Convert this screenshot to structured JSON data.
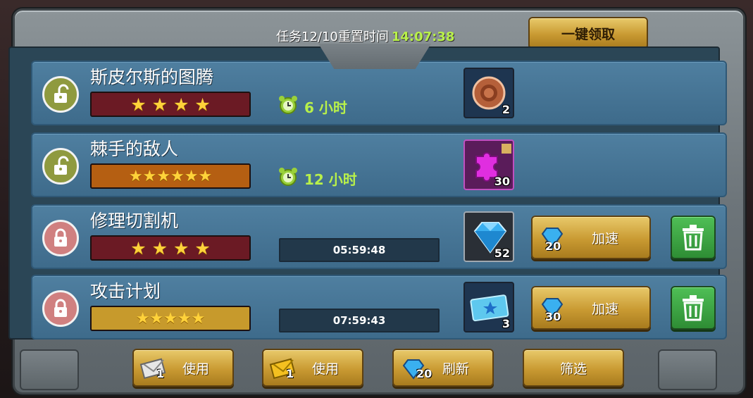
{
  "header": {
    "task_label": "任务12/10重置时间",
    "reset_time": "14:07:38",
    "claim_all_label": "一键领取"
  },
  "tasks": [
    {
      "title": "斯皮尔斯的图腾",
      "stars": 4,
      "stars_text": "★ ★ ★ ★",
      "lock_state": "unlocked",
      "duration": "6 小时",
      "reward_type": "coin",
      "reward_count": "2"
    },
    {
      "title": "棘手的敌人",
      "stars": 6,
      "stars_text": "★★★★★★",
      "lock_state": "unlocked",
      "duration": "12 小时",
      "reward_type": "puzzle",
      "reward_count": "30"
    },
    {
      "title": "修理切割机",
      "stars": 4,
      "stars_text": "★ ★ ★ ★",
      "lock_state": "locked",
      "countdown": "05:59:48",
      "reward_type": "diamond",
      "reward_count": "52",
      "speed_cost": "20",
      "speed_label": "加速"
    },
    {
      "title": "攻击计划",
      "stars": 5,
      "stars_text": "★★★★★",
      "lock_state": "locked",
      "countdown": "07:59:43",
      "reward_type": "ticket",
      "reward_count": "3",
      "speed_cost": "30",
      "speed_label": "加速"
    }
  ],
  "footer": {
    "use_silver_count": "1",
    "use_silver_label": "使用",
    "use_gold_count": "1",
    "use_gold_label": "使用",
    "refresh_cost": "20",
    "refresh_label": "刷新",
    "filter_label": "筛选"
  },
  "colors": {
    "accent_green": "#b8f04a",
    "gold_button": "#c99a32",
    "row_blue": "#3e6b8b",
    "trash_green": "#2e8d34"
  },
  "icons": [
    "unlock-icon",
    "lock-icon",
    "alarm-clock-icon",
    "coin-icon",
    "puzzle-icon",
    "diamond-icon",
    "ticket-icon",
    "trash-icon",
    "envelope-icon"
  ]
}
